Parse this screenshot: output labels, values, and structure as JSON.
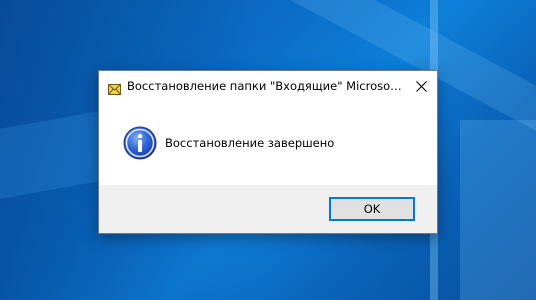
{
  "dialog": {
    "title": "Восстановление папки \"Входящие\" Microsoft Ou...",
    "app_icon": "outlook-envelope-icon",
    "close_icon": "close-icon",
    "message_icon": "info-icon",
    "message": "Восстановление завершено",
    "ok_label": "OK"
  },
  "colors": {
    "desktop_blue": "#0b6cc6",
    "accent": "#0078d7",
    "footer_bg": "#f0f0f0",
    "button_bg": "#e1e1e1"
  }
}
